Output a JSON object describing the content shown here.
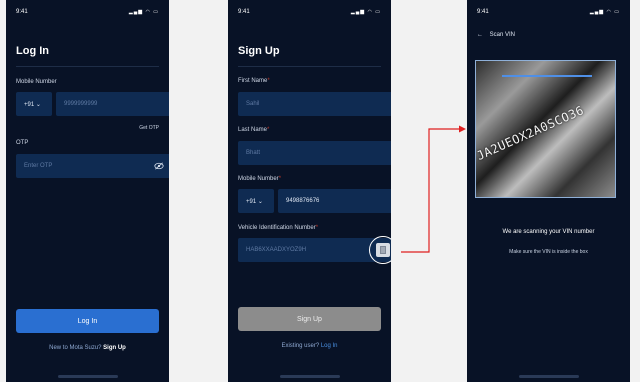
{
  "login": {
    "time": "9:41",
    "status_icons": "▂▄▆ ◠ ▭",
    "title": "Log In",
    "mobile_label": "Mobile Number",
    "country_code": "+91 ⌄",
    "mobile_placeholder": "9999999999",
    "get_otp": "Get OTP",
    "otp_label": "OTP",
    "otp_placeholder": "Enter OTP",
    "login_button": "Log In",
    "footer_prompt": "New to Mota Suzu?",
    "footer_link": "Sign Up"
  },
  "signup": {
    "time": "9:41",
    "status_icons": "▂▄▆ ◠ ▭",
    "title": "Sign Up",
    "first_name_label": "First Name",
    "first_name_placeholder": "Sahil",
    "last_name_label": "Last Name",
    "last_name_placeholder": "Bhatt",
    "mobile_label": "Mobile Number",
    "country_code": "+91 ⌄",
    "mobile_value": "9498876676",
    "vin_label": "Vehicle Identification Number",
    "vin_placeholder": "HAB6XXAADXYOZ9H",
    "signup_button": "Sign Up",
    "footer_prompt": "Existing user?",
    "footer_link": "Log In"
  },
  "scan": {
    "time": "9:41",
    "status_icons": "▂▄▆ ◠ ▭",
    "back_title": "Scan VIN",
    "vin_on_plate": "JA2UEOX2A0SCO36",
    "scanning_text": "We are scanning your VIN number",
    "hint_text": "Make sure the VIN is inside the box"
  },
  "colors": {
    "background": "#081226",
    "field": "#0f2b52",
    "primary": "#2a6fd1",
    "connector": "#e02020"
  }
}
